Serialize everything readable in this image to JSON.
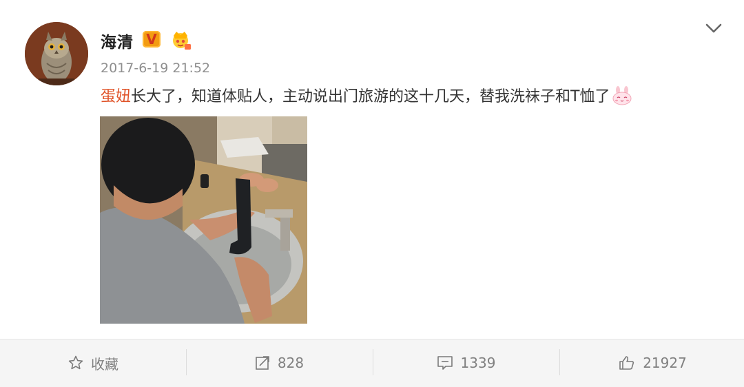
{
  "post": {
    "username": "海清",
    "verified_badge": "V",
    "member_icon": "crown-badge-icon",
    "timestamp": "2017-6-19 21:52",
    "mention": "蛋妞",
    "body": "长大了，知道体贴人，主动说出门旅游的这十几天，替我洗袜子和T恤了",
    "emoji": "bunny-emoji",
    "image_description_icon": "photo"
  },
  "actions": {
    "favorite_label": "收藏",
    "repost_count": "828",
    "comment_count": "1339",
    "like_count": "21927"
  },
  "colors": {
    "mention": "#e0542a",
    "muted_text": "#808080",
    "bar_bg": "#f5f5f5"
  }
}
